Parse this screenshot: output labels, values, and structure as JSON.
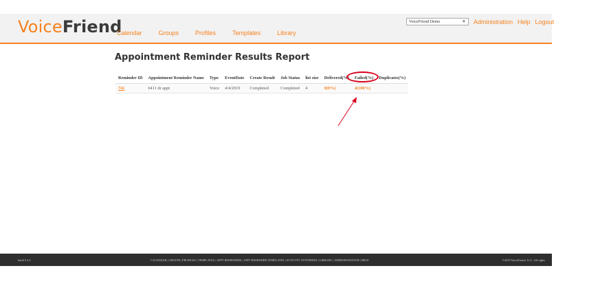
{
  "header": {
    "logo_voice": "Voice",
    "logo_friend": "Friend",
    "nav": [
      "Calendar",
      "Groups",
      "Profiles",
      "Templates",
      "Library"
    ],
    "account_select": "VoiceFriend Demo",
    "top_links": [
      "Administration",
      "Help",
      "Logout"
    ]
  },
  "page": {
    "title": "Appointment Reminder Results Report"
  },
  "table": {
    "columns": [
      "Reminder ID",
      "Appointment Reminder Name",
      "Type",
      "EventDate",
      "Create Result",
      "Job Status",
      "list size",
      "Delivered(%)",
      "Failed(%)",
      "Duplicates(%)"
    ],
    "rows": [
      {
        "reminder_id": "741",
        "name": "0411 dr appt",
        "type": "Voice",
        "event_date": "4/4/2019",
        "create_result": "Completed",
        "job_status": "Completed",
        "list_size": "4",
        "delivered": "0(0%)",
        "failed": "4(100%)",
        "duplicates": ""
      }
    ]
  },
  "footer": {
    "build": "build 5.3.4",
    "links": [
      "CALENDAR",
      "GROUPS",
      "PROFILES",
      "TEMPLATES",
      "APPT REMINDERS",
      "APPT REMINDER TEMPLATES",
      "ACTIVITY ATTENDEES",
      "LIBRARY",
      "ADMINISTRATION",
      "HELP"
    ],
    "copyright": "©2019 VoiceFriend, LLC. All rights"
  },
  "colors": {
    "accent": "#f58220",
    "annotation": "#d9001b",
    "footer_bg": "#2e2e2e"
  }
}
